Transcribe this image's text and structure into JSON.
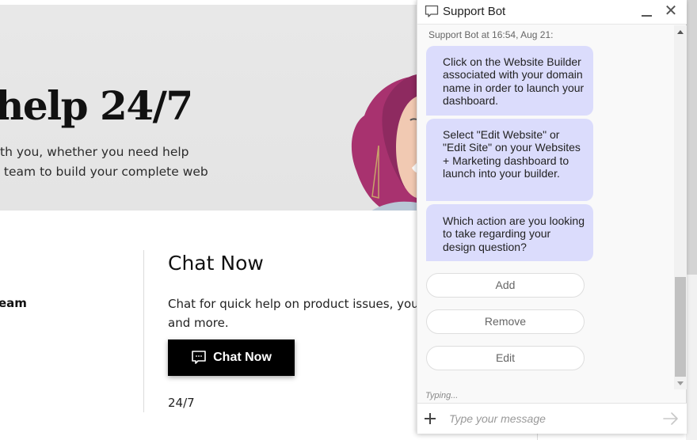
{
  "hero": {
    "title": "help 24/7",
    "subtitle_lines": [
      "th you, whether you need help",
      " team to build your complete web"
    ]
  },
  "left_column": {
    "label": "eam"
  },
  "chat_section": {
    "title": "Chat Now",
    "description_lines": [
      "Chat for quick help on product issues, your a",
      "and more."
    ],
    "button_label": "Chat Now",
    "button_icon": "chat-bubble-icon",
    "availability": "24/7"
  },
  "chat_widget": {
    "title": "Support Bot",
    "header_icon": "chat-bubble-icon",
    "minimize_icon": "minimize-icon",
    "close_icon": "close-icon",
    "close_glyph": "✕",
    "meta": "Support Bot at 16:54, Aug 21:",
    "messages": [
      {
        "sender": "bot",
        "text": "Click on the Website Builder associated with your domain name in order to launch your dashboard."
      },
      {
        "sender": "bot",
        "text": "Select \"Edit Website\" or \"Edit Site\" on your Websites + Marketing dashboard to launch into your builder."
      },
      {
        "sender": "bot",
        "text": "Which action are you looking to take regarding your design question?"
      }
    ],
    "quick_replies": [
      "Add",
      "Remove",
      "Edit"
    ],
    "typing_indicator": "Typing...",
    "composer": {
      "placeholder": "Type your message",
      "value": "",
      "attach_icon": "plus-icon",
      "send_icon": "send-arrow-icon"
    },
    "colors": {
      "bot_bubble": "#dbdcfc",
      "panel_bg": "#f9f9f9"
    }
  }
}
